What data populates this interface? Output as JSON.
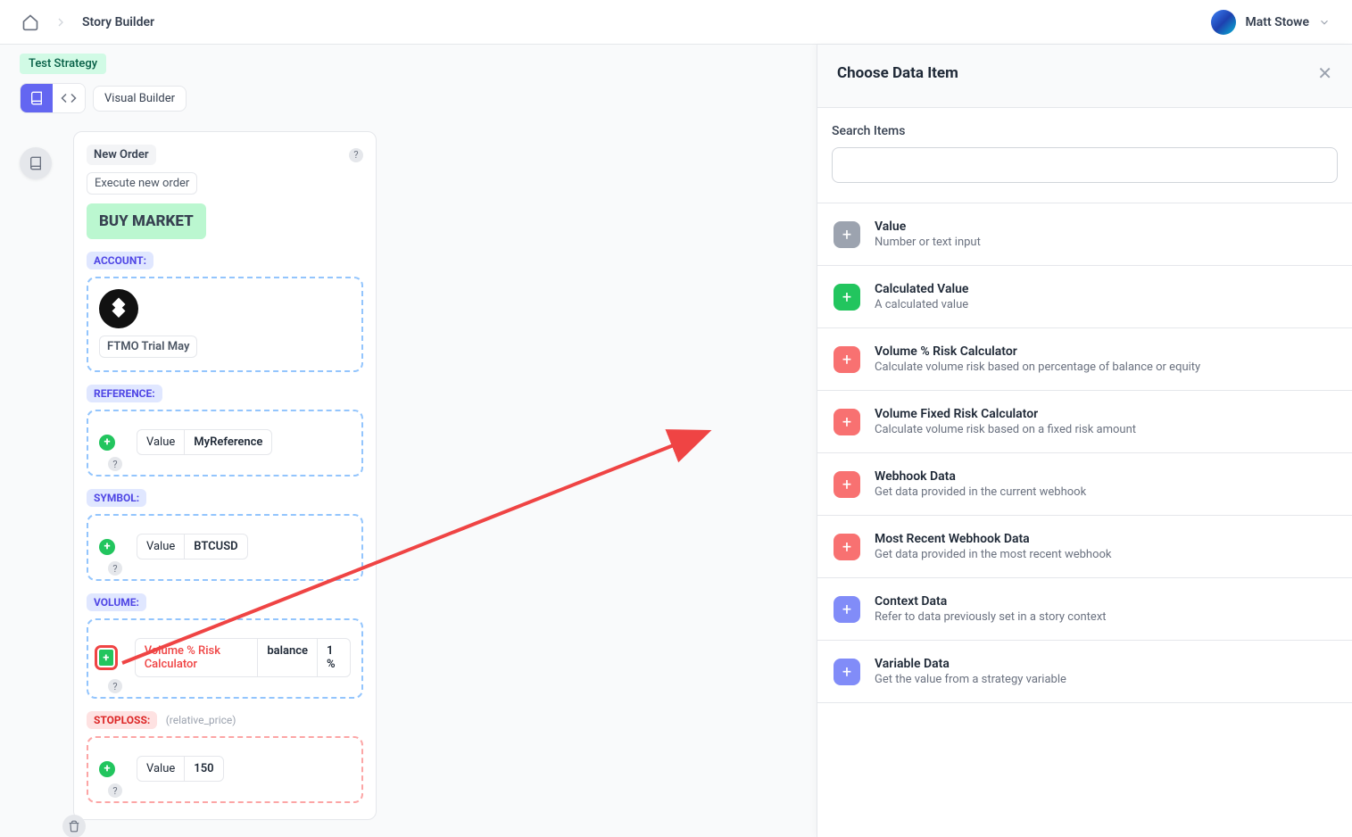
{
  "header": {
    "breadcrumb": "Story Builder",
    "username": "Matt Stowe"
  },
  "strategy_badge": "Test Strategy",
  "toolbar_label": "Visual Builder",
  "node": {
    "title": "New Order",
    "subtitle": "Execute new order",
    "action": "BUY MARKET",
    "sections": {
      "account": {
        "label": "ACCOUNT:",
        "name": "FTMO Trial May"
      },
      "reference": {
        "label": "REFERENCE:",
        "type": "Value",
        "value": "MyReference"
      },
      "symbol": {
        "label": "SYMBOL:",
        "type": "Value",
        "value": "BTCUSD"
      },
      "volume": {
        "label": "VOLUME:",
        "type": "Volume % Risk Calculator",
        "field": "balance",
        "amount": "1 %"
      },
      "stoploss": {
        "label": "STOPLOSS:",
        "note": "(relative_price)",
        "type": "Value",
        "value": "150"
      }
    }
  },
  "panel": {
    "title": "Choose Data Item",
    "search_label": "Search Items",
    "items": [
      {
        "title": "Value",
        "desc": "Number or text input",
        "icon": "ic-gray"
      },
      {
        "title": "Calculated Value",
        "desc": "A calculated value",
        "icon": "ic-green"
      },
      {
        "title": "Volume % Risk Calculator",
        "desc": "Calculate volume risk based on percentage of balance or equity",
        "icon": "ic-red"
      },
      {
        "title": "Volume Fixed Risk Calculator",
        "desc": "Calculate volume risk based on a fixed risk amount",
        "icon": "ic-red"
      },
      {
        "title": "Webhook Data",
        "desc": "Get data provided in the current webhook",
        "icon": "ic-red"
      },
      {
        "title": "Most Recent Webhook Data",
        "desc": "Get data provided in the most recent webhook",
        "icon": "ic-red"
      },
      {
        "title": "Context Data",
        "desc": "Refer to data previously set in a story context",
        "icon": "ic-purple"
      },
      {
        "title": "Variable Data",
        "desc": "Get the value from a strategy variable",
        "icon": "ic-purple"
      }
    ]
  }
}
